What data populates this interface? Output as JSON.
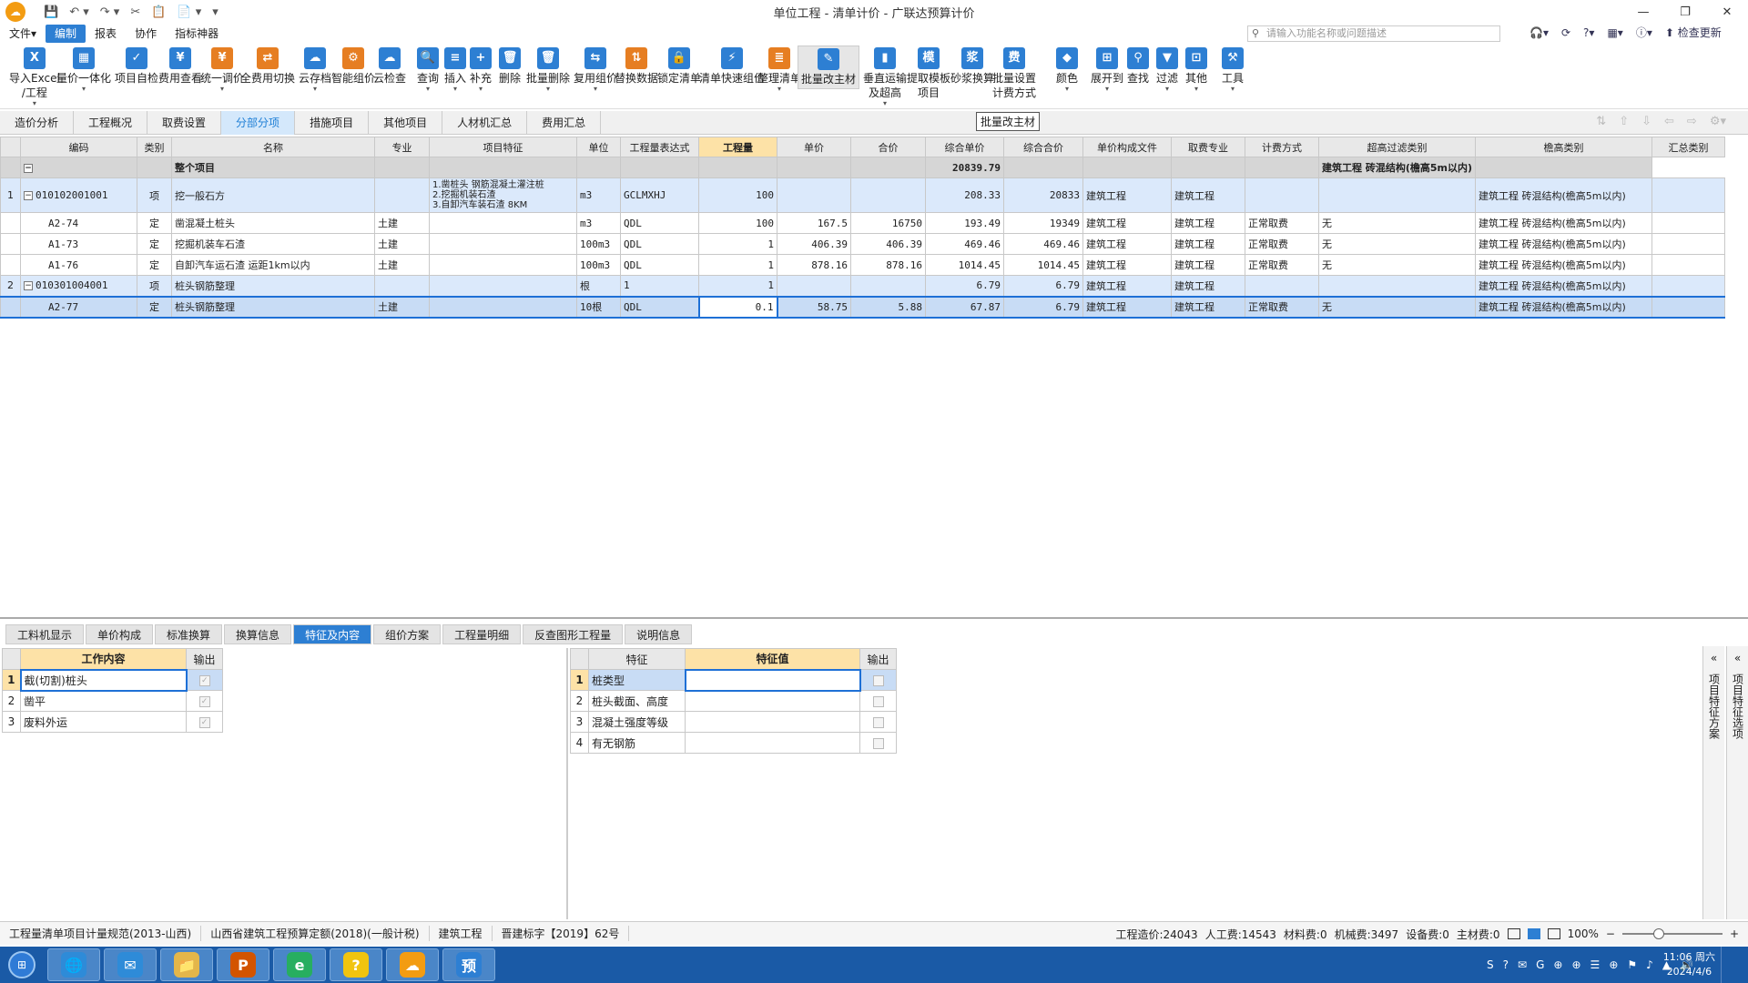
{
  "window": {
    "title": "单位工程 - 清单计价 - 广联达预算计价",
    "logo": "☁",
    "buttons": [
      "—",
      "❐",
      "✕"
    ]
  },
  "quick_access": [
    "💾",
    "↶ ▾",
    "↷ ▾",
    "✂",
    "📋",
    "📄 ▾",
    "▾"
  ],
  "menu": [
    "文件▾",
    "编制",
    "报表",
    "协作",
    "指标神器"
  ],
  "search": {
    "placeholder": "请输入功能名称或问题描述"
  },
  "right_tools": {
    "icons": [
      "🎧▾",
      "⟳",
      "?▾",
      "▦▾",
      "ⓘ▾"
    ],
    "check_update": "检查更新"
  },
  "ribbon": [
    {
      "label": "导入Excel\n/工程",
      "color": "#2d7fd3",
      "icon": "X"
    },
    {
      "label": "量价一体化",
      "color": "#2d7fd3",
      "icon": "▦"
    },
    {
      "label": "项目自检",
      "color": "#2d7fd3",
      "icon": "✓"
    },
    {
      "label": "费用查看",
      "color": "#2d7fd3",
      "icon": "¥"
    },
    {
      "label": "统一调价",
      "color": "#e67e22",
      "icon": "¥"
    },
    {
      "label": "全费用切换",
      "color": "#e67e22",
      "icon": "⇄"
    },
    {
      "label": "云存档",
      "color": "#2d7fd3",
      "icon": "☁"
    },
    {
      "label": "智能组价",
      "color": "#e67e22",
      "icon": "⚙"
    },
    {
      "label": "云检查",
      "color": "#2d7fd3",
      "icon": "☁"
    },
    {
      "label": "查询",
      "color": "#2d7fd3",
      "icon": "🔍"
    },
    {
      "label": "插入",
      "color": "#2d7fd3",
      "icon": "≡"
    },
    {
      "label": "补充",
      "color": "#2d7fd3",
      "icon": "+"
    },
    {
      "label": "删除",
      "color": "#2d7fd3",
      "icon": "🗑"
    },
    {
      "label": "批量删除",
      "color": "#2d7fd3",
      "icon": "🗑"
    },
    {
      "label": "复用组价",
      "color": "#2d7fd3",
      "icon": "⇆"
    },
    {
      "label": "替换数据",
      "color": "#e67e22",
      "icon": "⇅"
    },
    {
      "label": "锁定清单",
      "color": "#2d7fd3",
      "icon": "🔒"
    },
    {
      "label": "清单快速组价",
      "color": "#2d7fd3",
      "icon": "⚡"
    },
    {
      "label": "整理清单",
      "color": "#e67e22",
      "icon": "≣"
    },
    {
      "label": "批量改主材",
      "color": "#2d7fd3",
      "icon": "✎"
    },
    {
      "label": "垂直运输\n及超高",
      "color": "#2d7fd3",
      "icon": "▮"
    },
    {
      "label": "提取模板\n项目",
      "color": "#2d7fd3",
      "icon": "模"
    },
    {
      "label": "砂浆换算",
      "color": "#2d7fd3",
      "icon": "浆"
    },
    {
      "label": "批量设置\n计费方式",
      "color": "#2d7fd3",
      "icon": "费"
    },
    {
      "label": "颜色",
      "color": "#2d7fd3",
      "icon": "◆"
    },
    {
      "label": "展开到",
      "color": "#2d7fd3",
      "icon": "⊞"
    },
    {
      "label": "查找",
      "color": "#2d7fd3",
      "icon": "⚲"
    },
    {
      "label": "过滤",
      "color": "#2d7fd3",
      "icon": "▼"
    },
    {
      "label": "其他",
      "color": "#2d7fd3",
      "icon": "⊡"
    },
    {
      "label": "工具",
      "color": "#2d7fd3",
      "icon": "⚒"
    }
  ],
  "tooltip": "批量改主材",
  "tabs": [
    "造价分析",
    "工程概况",
    "取费设置",
    "分部分项",
    "措施项目",
    "其他项目",
    "人材机汇总",
    "费用汇总"
  ],
  "tab_icons": [
    "⇅",
    "⇧",
    "⇩",
    "⇦",
    "⇨",
    "⚙▾"
  ],
  "grid": {
    "headers": [
      "编码",
      "类别",
      "名称",
      "专业",
      "项目特征",
      "单位",
      "工程量表达式",
      "工程量",
      "单价",
      "合价",
      "综合单价",
      "综合合价",
      "单价构成文件",
      "取费专业",
      "计费方式",
      "超高过滤类别",
      "檐高类别",
      "汇总类别"
    ],
    "whole": {
      "toggle": "−",
      "label": "整个项目",
      "total": "20839.79",
      "type": "建筑工程 砖混结构(檐高5m以内)"
    },
    "rows": [
      {
        "kind": "item",
        "idx": "1",
        "toggle": "−",
        "code": "010102001001",
        "cat": "项",
        "name": "挖一般石方",
        "spec": "",
        "feature": [
          "1.凿桩头 钢筋混凝土灌注桩",
          "2.挖掘机装石渣",
          "3.自卸汽车装石渣 8KM"
        ],
        "unit": "m3",
        "expr": "GCLMXHJ",
        "qty": "100",
        "price": "",
        "total": "",
        "uprice": "208.33",
        "utotal": "20833",
        "file": "建筑工程",
        "prof": "建筑工程",
        "method": "",
        "filter": "",
        "type": "建筑工程 砖混结构(檐高5m以内)"
      },
      {
        "kind": "sub",
        "idx": "",
        "toggle": "",
        "code": "A2-74",
        "cat": "定",
        "name": "凿混凝土桩头",
        "spec": "土建",
        "feature": [],
        "unit": "m3",
        "expr": "QDL",
        "qty": "100",
        "price": "167.5",
        "total": "16750",
        "uprice": "193.49",
        "utotal": "19349",
        "file": "建筑工程",
        "prof": "建筑工程",
        "method": "正常取费",
        "filter": "无",
        "type": "建筑工程 砖混结构(檐高5m以内)"
      },
      {
        "kind": "sub",
        "idx": "",
        "toggle": "",
        "code": "A1-73",
        "cat": "定",
        "name": "挖掘机装车石渣",
        "spec": "土建",
        "feature": [],
        "unit": "100m3",
        "expr": "QDL",
        "qty": "1",
        "price": "406.39",
        "total": "406.39",
        "uprice": "469.46",
        "utotal": "469.46",
        "file": "建筑工程",
        "prof": "建筑工程",
        "method": "正常取费",
        "filter": "无",
        "type": "建筑工程 砖混结构(檐高5m以内)"
      },
      {
        "kind": "sub",
        "idx": "",
        "toggle": "",
        "code": "A1-76",
        "cat": "定",
        "name": "自卸汽车运石渣 运距1km以内",
        "spec": "土建",
        "feature": [],
        "unit": "100m3",
        "expr": "QDL",
        "qty": "1",
        "price": "878.16",
        "total": "878.16",
        "uprice": "1014.45",
        "utotal": "1014.45",
        "file": "建筑工程",
        "prof": "建筑工程",
        "method": "正常取费",
        "filter": "无",
        "type": "建筑工程 砖混结构(檐高5m以内)"
      },
      {
        "kind": "item",
        "idx": "2",
        "toggle": "−",
        "code": "010301004001",
        "cat": "项",
        "name": "桩头钢筋整理",
        "spec": "",
        "feature": [],
        "unit": "根",
        "expr": "1",
        "qty": "1",
        "price": "",
        "total": "",
        "uprice": "6.79",
        "utotal": "6.79",
        "file": "建筑工程",
        "prof": "建筑工程",
        "method": "",
        "filter": "",
        "type": "建筑工程 砖混结构(檐高5m以内)"
      },
      {
        "kind": "sel",
        "idx": "",
        "toggle": "",
        "code": "A2-77",
        "cat": "定",
        "name": "桩头钢筋整理",
        "spec": "土建",
        "feature": [],
        "unit": "10根",
        "expr": "QDL",
        "qty": "0.1",
        "price": "58.75",
        "total": "5.88",
        "uprice": "67.87",
        "utotal": "6.79",
        "file": "建筑工程",
        "prof": "建筑工程",
        "method": "正常取费",
        "filter": "无",
        "type": "建筑工程 砖混结构(檐高5m以内)"
      }
    ]
  },
  "sub_tabs": [
    "工料机显示",
    "单价构成",
    "标准换算",
    "换算信息",
    "特征及内容",
    "组价方案",
    "工程量明细",
    "反查图形工程量",
    "说明信息"
  ],
  "work": {
    "headers": [
      "工作内容",
      "输出"
    ],
    "rows": [
      {
        "idx": "1",
        "text": "截(切割)桩头",
        "check": "✓"
      },
      {
        "idx": "2",
        "text": "凿平",
        "check": "✓"
      },
      {
        "idx": "3",
        "text": "废料外运",
        "check": "✓"
      }
    ]
  },
  "feature": {
    "headers": [
      "特征",
      "特征值",
      "输出"
    ],
    "rows": [
      {
        "idx": "1",
        "name": "桩类型",
        "value": ""
      },
      {
        "idx": "2",
        "name": "桩头截面、高度",
        "value": ""
      },
      {
        "idx": "3",
        "name": "混凝土强度等级",
        "value": ""
      },
      {
        "idx": "4",
        "name": "有无钢筋",
        "value": ""
      }
    ]
  },
  "side_panels": [
    {
      "arrow": "«",
      "label": "项目特征方案"
    },
    {
      "arrow": "«",
      "label": "项目特征选项"
    }
  ],
  "status": {
    "left": [
      "工程量清单项目计量规范(2013-山西)",
      "山西省建筑工程预算定额(2018)(一般计税)",
      "建筑工程",
      "晋建标字【2019】62号"
    ],
    "cost": "工程造价:24043",
    "labor": "人工费:14543",
    "material": "材料费:0",
    "machine": "机械费:3497",
    "equipment": "设备费:0",
    "main_material": "主材费:0",
    "zoom": "100%"
  },
  "taskbar": {
    "apps": [
      {
        "icon": "🌐",
        "color": "#2e8bd8"
      },
      {
        "icon": "✉",
        "color": "#2e8bd8"
      },
      {
        "icon": "📁",
        "color": "#e3b64a"
      },
      {
        "icon": "P",
        "color": "#d35400"
      },
      {
        "icon": "e",
        "color": "#27ae60"
      },
      {
        "icon": "?",
        "color": "#f1c40f"
      },
      {
        "icon": "☁",
        "color": "#f39c12"
      },
      {
        "icon": "预",
        "color": "#2d7fd3"
      }
    ],
    "tray": [
      "S",
      "?",
      "✉",
      "G",
      "⊕",
      "⊕",
      "☰",
      "⊕",
      "⚑",
      "♪",
      "▲",
      "🔊"
    ],
    "time": "11:06 周六",
    "date": "2024/4/6"
  }
}
